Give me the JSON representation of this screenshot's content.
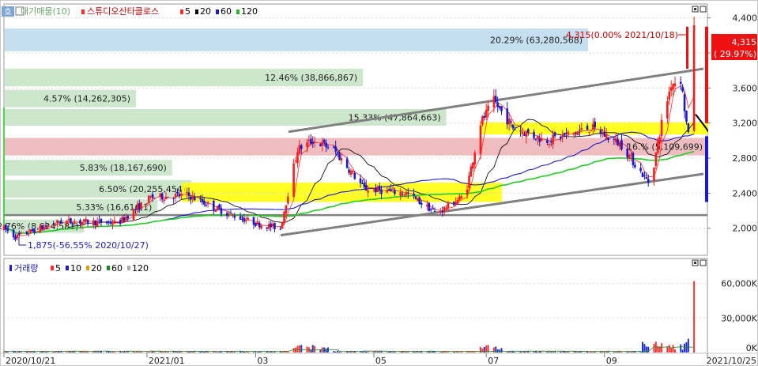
{
  "header": {
    "badge": "호",
    "ma_legend": "대기매물(10)",
    "stock_name": "스튜디오산타클로스",
    "ma_periods": [
      {
        "label": "5",
        "color": "#ff2a2a"
      },
      {
        "label": "20",
        "color": "#000000"
      },
      {
        "label": "60",
        "color": "#1a1acc"
      },
      {
        "label": "120",
        "color": "#22bb22"
      }
    ]
  },
  "volume_header": {
    "title": "거래량",
    "periods": [
      {
        "label": "5",
        "color": "#ff2a2a"
      },
      {
        "label": "10",
        "color": "#1a1acc"
      },
      {
        "label": "20",
        "color": "#e0a000"
      },
      {
        "label": "60",
        "color": "#228822"
      },
      {
        "label": "120",
        "color": "#aaaaaa"
      }
    ]
  },
  "chart_data": [
    {
      "type": "candlestick",
      "ylim": [
        1700,
        4550
      ],
      "y_ticks": [
        2000,
        2400,
        2800,
        3200,
        3600,
        4000,
        4400
      ],
      "y_tick_labels": [
        "2,000",
        "2,400",
        "2,800",
        "3,200",
        "3,600",
        "4,000",
        "4,400"
      ],
      "x_start": "2020/10/21",
      "x_end": "2021/10/25",
      "x_ticks": [
        {
          "date": "2020/10/21",
          "label": "2020/10/21"
        },
        {
          "date": "2021/01/04",
          "label": "2021/01"
        },
        {
          "date": "2021/03/02",
          "label": "03"
        },
        {
          "date": "2021/05/03",
          "label": "05"
        },
        {
          "date": "2021/07/01",
          "label": "07"
        },
        {
          "date": "2021/09/01",
          "label": "09"
        },
        {
          "date": "2021/10/25",
          "label": "2021/10/25"
        }
      ],
      "current_price": {
        "value": 4315,
        "label": "4,315",
        "change": "( 29.97%)"
      },
      "annotations": [
        {
          "text": "4,315(0.00% 2021/10/18)",
          "color": "#d00000"
        },
        {
          "text": "1,875(-56.55% 2020/10/27)",
          "color": "#1a1acc"
        }
      ],
      "volume_profile": [
        {
          "text": "20.29% (63,280,568)",
          "price_low": 4020,
          "price_high": 4280,
          "length": 1.0,
          "color": "#c6dff0"
        },
        {
          "text": "12.46% (38,866,867)",
          "price_low": 3620,
          "price_high": 3820,
          "length": 0.614,
          "color": "#cde7cd"
        },
        {
          "text": "4.57% (14,262,305)",
          "price_low": 3380,
          "price_high": 3580,
          "length": 0.225,
          "color": "#cde7cd"
        },
        {
          "text": "15.33% (47,864,663)",
          "price_low": 3170,
          "price_high": 3360,
          "length": 0.757,
          "color": "#cde7cd"
        },
        {
          "text": "16.% (5,109,699)",
          "price_low": 2830,
          "price_high": 3030,
          "length": 1.0,
          "color": "#efbcc0"
        },
        {
          "text": "5.83% (18,167,690)",
          "price_low": 2600,
          "price_high": 2780,
          "length": 0.287,
          "color": "#cde7cd"
        },
        {
          "text": "6.50% (20,255,454)",
          "price_low": 2350,
          "price_high": 2550,
          "length": 0.32,
          "color": "#cde7cd"
        },
        {
          "text": "5.33% (16,616,1)",
          "price_low": 2150,
          "price_high": 2330,
          "length": 0.262,
          "color": "#cde7cd"
        },
        {
          "text": "2.76% (8,624,581)",
          "price_low": 1950,
          "price_high": 2100,
          "length": 0.136,
          "color": "#cde7cd"
        }
      ],
      "volume_axis": {
        "ylim": [
          0,
          70000
        ],
        "ticks": [
          0,
          30000,
          60000
        ],
        "tick_labels": [
          "0K",
          "30,000K",
          "60,000K"
        ]
      }
    }
  ]
}
